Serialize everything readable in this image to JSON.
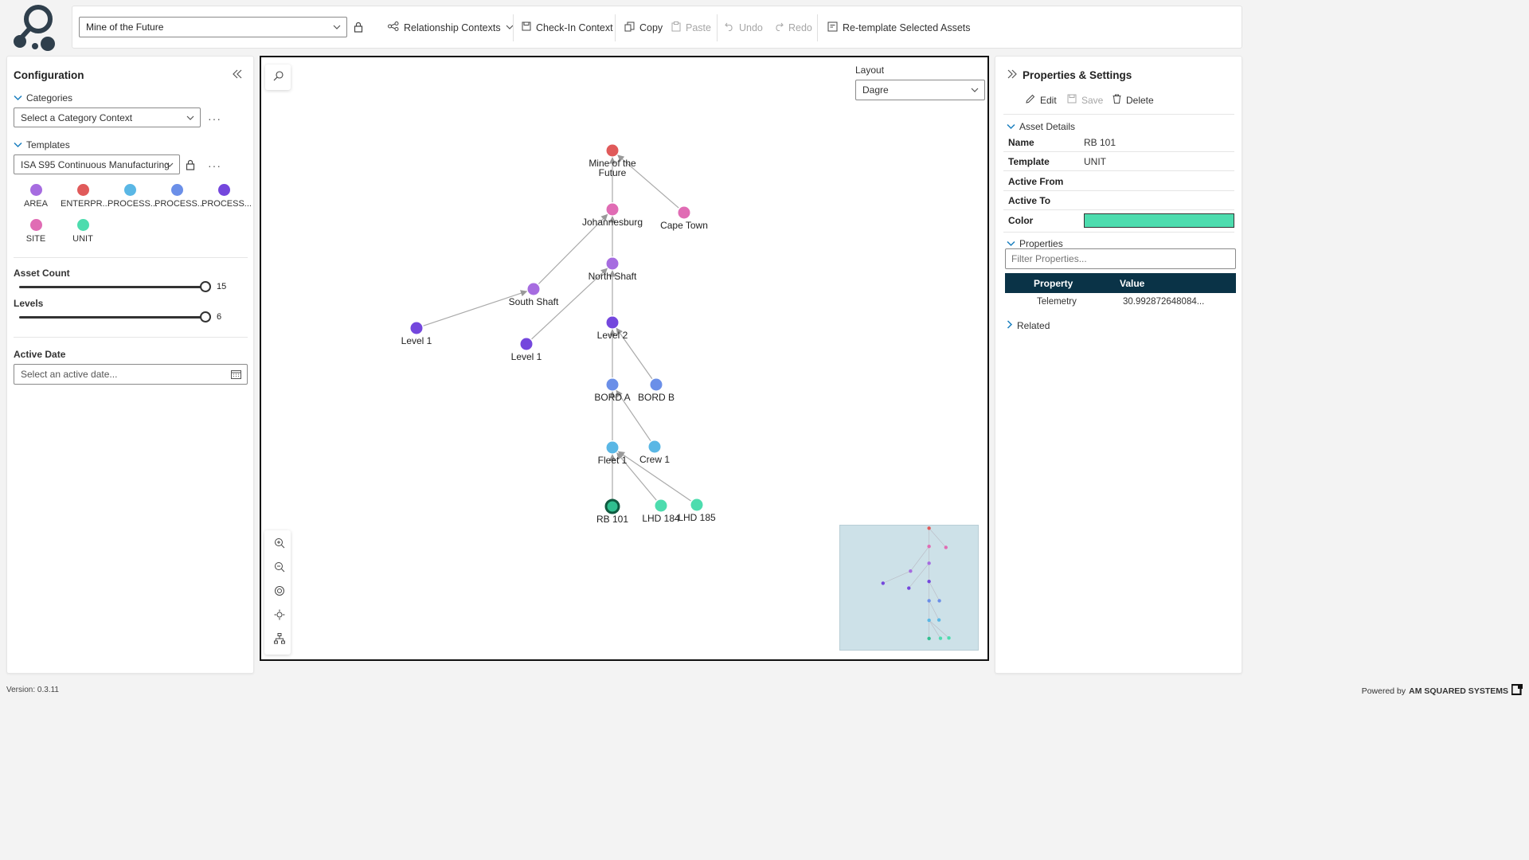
{
  "toolbar": {
    "context_value": "Mine of the Future",
    "relationship_contexts": "Relationship Contexts",
    "check_in_context": "Check-In Context",
    "copy": "Copy",
    "paste": "Paste",
    "undo": "Undo",
    "redo": "Redo",
    "retemplate": "Re-template Selected Assets"
  },
  "config": {
    "title": "Configuration",
    "categories_label": "Categories",
    "category_placeholder": "Select a Category Context",
    "templates_label": "Templates",
    "template_value": "ISA S95 Continuous Manufacturing",
    "legend": [
      {
        "label": "AREA",
        "color": "#a66ce0"
      },
      {
        "label": "ENTERPR...",
        "color": "#e05a5a"
      },
      {
        "label": "PROCESS...",
        "color": "#5ab7e5"
      },
      {
        "label": "PROCESS...",
        "color": "#6b8fe8"
      },
      {
        "label": "PROCESS...",
        "color": "#7447dd"
      },
      {
        "label": "SITE",
        "color": "#e06cb4"
      },
      {
        "label": "UNIT",
        "color": "#4ddcae"
      }
    ],
    "asset_count_label": "Asset Count",
    "asset_count_value": "15",
    "levels_label": "Levels",
    "levels_value": "6",
    "active_date_label": "Active Date",
    "active_date_placeholder": "Select an active date..."
  },
  "canvas": {
    "layout_label": "Layout",
    "layout_value": "Dagre",
    "nodes": [
      {
        "id": "mine",
        "label": "Mine of the\nFuture",
        "color": "#e05a5a"
      },
      {
        "id": "jhb",
        "label": "Johannesburg",
        "color": "#e06cb4"
      },
      {
        "id": "cpt",
        "label": "Cape Town",
        "color": "#e06cb4"
      },
      {
        "id": "north",
        "label": "North Shaft",
        "color": "#a66ce0"
      },
      {
        "id": "south",
        "label": "South Shaft",
        "color": "#a66ce0"
      },
      {
        "id": "lvl1a",
        "label": "Level 1",
        "color": "#7447dd"
      },
      {
        "id": "lvl1b",
        "label": "Level 1",
        "color": "#7447dd"
      },
      {
        "id": "lvl2",
        "label": "Level 2",
        "color": "#7447dd"
      },
      {
        "id": "borda",
        "label": "BORD A",
        "color": "#6b8fe8"
      },
      {
        "id": "bordb",
        "label": "BORD B",
        "color": "#6b8fe8"
      },
      {
        "id": "fleet1",
        "label": "Fleet 1",
        "color": "#5ab7e5"
      },
      {
        "id": "crew1",
        "label": "Crew 1",
        "color": "#5ab7e5"
      },
      {
        "id": "rb101",
        "label": "RB 101",
        "color": "#2fbf8f",
        "selected": true
      },
      {
        "id": "lhd184",
        "label": "LHD 184",
        "color": "#4ddcae"
      },
      {
        "id": "lhd185",
        "label": "LHD 185",
        "color": "#4ddcae"
      }
    ],
    "edges": [
      [
        "jhb",
        "mine"
      ],
      [
        "cpt",
        "mine"
      ],
      [
        "north",
        "jhb"
      ],
      [
        "south",
        "jhb"
      ],
      [
        "lvl1a",
        "south"
      ],
      [
        "lvl1b",
        "north"
      ],
      [
        "lvl2",
        "north"
      ],
      [
        "borda",
        "lvl2"
      ],
      [
        "bordb",
        "lvl2"
      ],
      [
        "fleet1",
        "borda"
      ],
      [
        "crew1",
        "borda"
      ],
      [
        "rb101",
        "fleet1"
      ],
      [
        "lhd184",
        "fleet1"
      ],
      [
        "lhd185",
        "fleet1"
      ]
    ]
  },
  "props": {
    "title": "Properties & Settings",
    "edit": "Edit",
    "save": "Save",
    "delete": "Delete",
    "asset_details": "Asset Details",
    "name_key": "Name",
    "name_val": "RB 101",
    "template_key": "Template",
    "template_val": "UNIT",
    "active_from_key": "Active From",
    "active_to_key": "Active To",
    "color_key": "Color",
    "color_val": "#4ddcae",
    "properties_label": "Properties",
    "filter_placeholder": "Filter Properties...",
    "col_property": "Property",
    "col_value": "Value",
    "rows": [
      {
        "property": "Telemetry",
        "value": "30.992872648084..."
      }
    ],
    "related_label": "Related"
  },
  "footer": {
    "version": "Version: 0.3.11",
    "powered_by": "Powered by",
    "brand": "AM SQUARED SYSTEMS"
  }
}
